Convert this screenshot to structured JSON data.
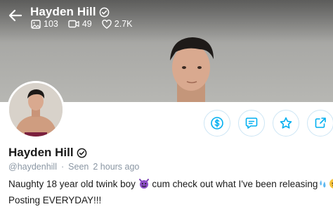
{
  "header": {
    "name": "Hayden Hill",
    "stats": [
      {
        "icon": "image-icon",
        "value": "103"
      },
      {
        "icon": "video-icon",
        "value": "49"
      },
      {
        "icon": "heart-icon",
        "value": "2.7K"
      }
    ]
  },
  "profile": {
    "name": "Hayden Hill",
    "handle": "@haydenhill",
    "separator": "·",
    "seen": "Seen",
    "last_seen": "2 hours ago",
    "bio_line1_a": "Naughty 18 year old twink boy",
    "bio_line1_b": "cum check out what I've been releasing",
    "bio_line2": "Posting EVERYDAY!!!"
  },
  "actions": [
    {
      "name": "tip-button",
      "icon": "dollar-icon"
    },
    {
      "name": "message-button",
      "icon": "message-icon"
    },
    {
      "name": "favorite-button",
      "icon": "star-icon"
    },
    {
      "name": "share-button",
      "icon": "share-icon"
    }
  ],
  "colors": {
    "accent": "#00aff0",
    "muted": "#8a96a3",
    "action_border": "#cde6f5"
  }
}
